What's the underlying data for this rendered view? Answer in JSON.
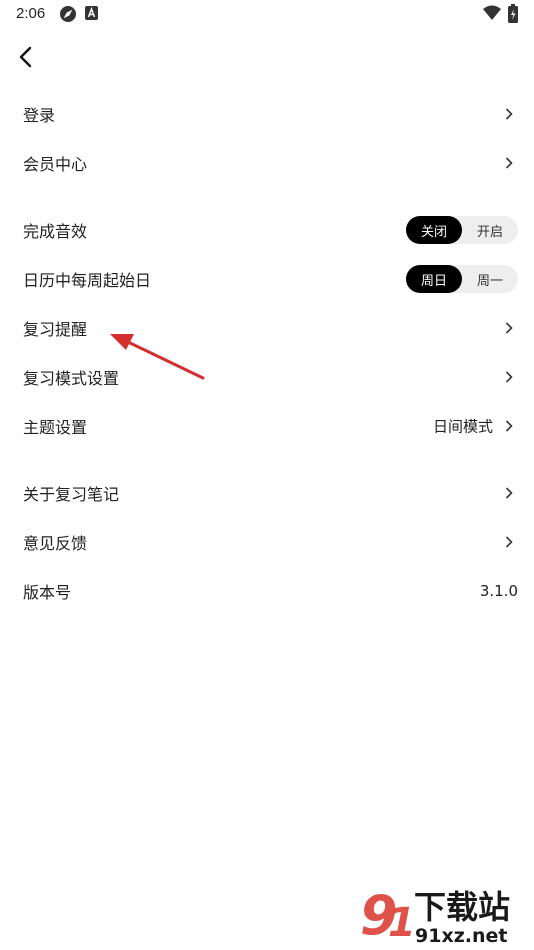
{
  "status_bar": {
    "time": "2:06"
  },
  "colors": {
    "accent": "#000000",
    "segment_bg": "#eeeeee",
    "annotation_arrow": "#d32f2f",
    "watermark": "#d9342b"
  },
  "menu": {
    "login": "登录",
    "vip_center": "会员中心",
    "sound": {
      "label": "完成音效",
      "off": "关闭",
      "on": "开启",
      "selected": "关闭"
    },
    "week_start": {
      "label": "日历中每周起始日",
      "sunday": "周日",
      "monday": "周一",
      "selected": "周日"
    },
    "review_reminder": "复习提醒",
    "review_mode": "复习模式设置",
    "theme": {
      "label": "主题设置",
      "value": "日间模式"
    },
    "about": "关于复习笔记",
    "feedback": "意见反馈",
    "version": {
      "label": "版本号",
      "value": "3.1.0"
    }
  },
  "watermark": {
    "brand": "下载站",
    "domain": "91xz.net"
  }
}
